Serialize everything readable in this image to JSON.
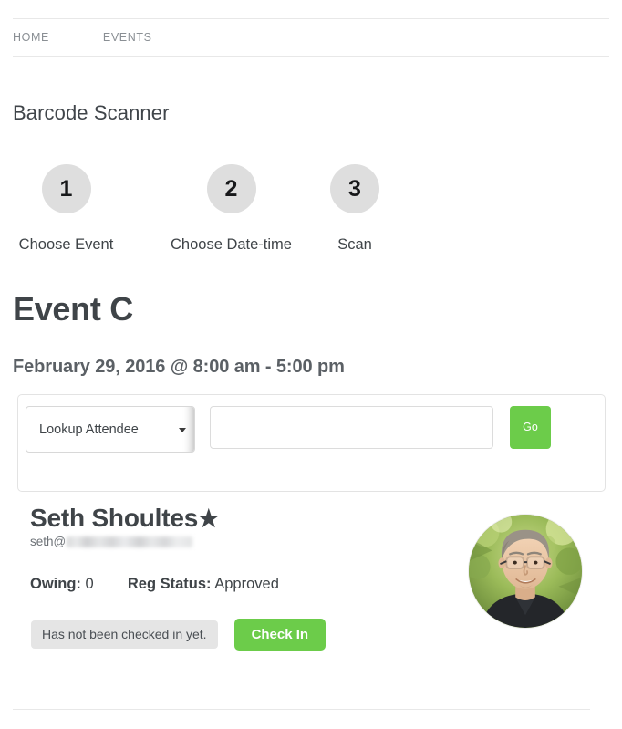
{
  "nav": {
    "items": [
      {
        "label": "HOME",
        "name": "nav-item-home"
      },
      {
        "label": "EVENTS",
        "name": "nav-item-events"
      }
    ]
  },
  "page": {
    "title": "Barcode Scanner"
  },
  "steps": [
    {
      "number": "1",
      "label": "Choose Event"
    },
    {
      "number": "2",
      "label": "Choose Date-time"
    },
    {
      "number": "3",
      "label": "Scan"
    }
  ],
  "event": {
    "name": "Event C",
    "datetime": "February 29, 2016 @ 8:00 am - 5:00 pm"
  },
  "lookup": {
    "select_value": "Lookup Attendee",
    "select_options": [
      "Lookup Attendee"
    ],
    "input_value": "",
    "input_placeholder": "",
    "go_label": "Go",
    "dropdown_icon": "chevron-down-icon"
  },
  "attendee": {
    "name": "Seth Shoultes",
    "star_icon": "★",
    "email_prefix": "seth@",
    "email_redacted": true,
    "owing_label": "Owing:",
    "owing_value": "0",
    "reg_status_label": "Reg Status:",
    "reg_status_value": "Approved",
    "checkin_status": "Has not been checked in yet.",
    "checkin_button": "Check In",
    "avatar_alt": "attendee-photo"
  },
  "colors": {
    "green": "#6ccc4a",
    "step_circle": "#dedede",
    "badge": "#e5e5e5",
    "text": "#3f4448",
    "nav_text": "#8a8f94",
    "border": "#e8e8e8"
  }
}
